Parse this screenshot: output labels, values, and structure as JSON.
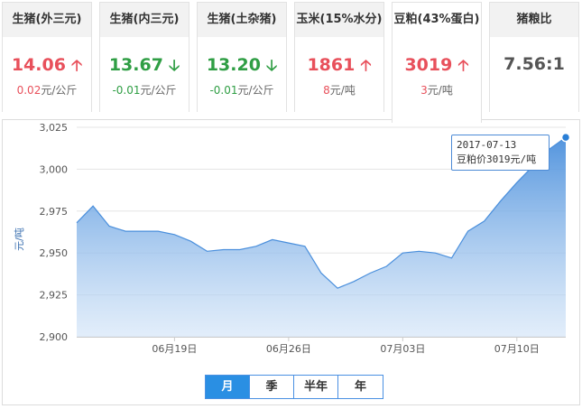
{
  "cards": [
    {
      "title": "生猪(外三元)",
      "price": "14.06",
      "direction": "up",
      "change": "0.02",
      "unit": "元/公斤"
    },
    {
      "title": "生猪(内三元)",
      "price": "13.67",
      "direction": "down",
      "change": "-0.01",
      "unit": "元/公斤"
    },
    {
      "title": "生猪(土杂猪)",
      "price": "13.20",
      "direction": "down",
      "change": "-0.01",
      "unit": "元/公斤"
    },
    {
      "title": "玉米(15%水分)",
      "price": "1861",
      "direction": "up",
      "change": "8",
      "unit": "元/吨"
    },
    {
      "title": "豆粕(43%蛋白)",
      "price": "3019",
      "direction": "up",
      "change": "3",
      "unit": "元/吨",
      "active": true
    },
    {
      "title": "猪粮比",
      "price": "7.56:1",
      "direction": "none"
    }
  ],
  "colors": {
    "up": "#e8505b",
    "down": "#2f9e44",
    "line": "#4a8fdc",
    "accent": "#2a8fe3"
  },
  "chart_data": {
    "type": "area",
    "ylabel": "元/吨",
    "ylim": [
      2900,
      3025
    ],
    "yticks": [
      "2,900",
      "2,925",
      "2,950",
      "2,975",
      "3,000",
      "3,025"
    ],
    "x": [
      "06-13",
      "06-14",
      "06-15",
      "06-16",
      "06-19",
      "06-20",
      "06-21",
      "06-22",
      "06-23",
      "06-26",
      "06-27",
      "06-28",
      "06-29",
      "06-30",
      "07-03",
      "07-04",
      "07-05",
      "07-06",
      "07-07",
      "07-10",
      "07-11",
      "07-12",
      "07-13"
    ],
    "xtick_labels": [
      {
        "x": "06-19",
        "label": "06月19日"
      },
      {
        "x": "06-26",
        "label": "06月26日"
      },
      {
        "x": "07-03",
        "label": "07月03日"
      },
      {
        "x": "07-10",
        "label": "07月10日"
      }
    ],
    "y_dates": [
      "2017-06-13",
      "2017-06-14",
      "2017-06-15",
      "2017-06-16",
      "2017-06-17",
      "2017-06-18",
      "2017-06-19",
      "2017-06-20",
      "2017-06-21",
      "2017-06-22",
      "2017-06-23",
      "2017-06-24",
      "2017-06-25",
      "2017-06-26",
      "2017-06-27",
      "2017-06-28",
      "2017-06-29",
      "2017-06-30",
      "2017-07-01",
      "2017-07-02",
      "2017-07-03",
      "2017-07-04",
      "2017-07-05",
      "2017-07-06",
      "2017-07-07",
      "2017-07-08",
      "2017-07-09",
      "2017-07-10",
      "2017-07-11",
      "2017-07-12",
      "2017-07-13"
    ],
    "values": [
      2968,
      2978,
      2966,
      2963,
      2963,
      2963,
      2961,
      2957,
      2951,
      2952,
      2952,
      2954,
      2958,
      2956,
      2954,
      2938,
      2929,
      2933,
      2938,
      2942,
      2950,
      2951,
      2950,
      2947,
      2963,
      2969,
      2981,
      2992,
      3002,
      3012,
      3019
    ],
    "tooltip": {
      "date": "2017-07-13",
      "text": "豆粕价3019元/吨"
    },
    "grid": true,
    "legend": "none"
  },
  "range_tabs": [
    {
      "label": "月",
      "active": true
    },
    {
      "label": "季",
      "active": false
    },
    {
      "label": "半年",
      "active": false
    },
    {
      "label": "年",
      "active": false
    }
  ]
}
